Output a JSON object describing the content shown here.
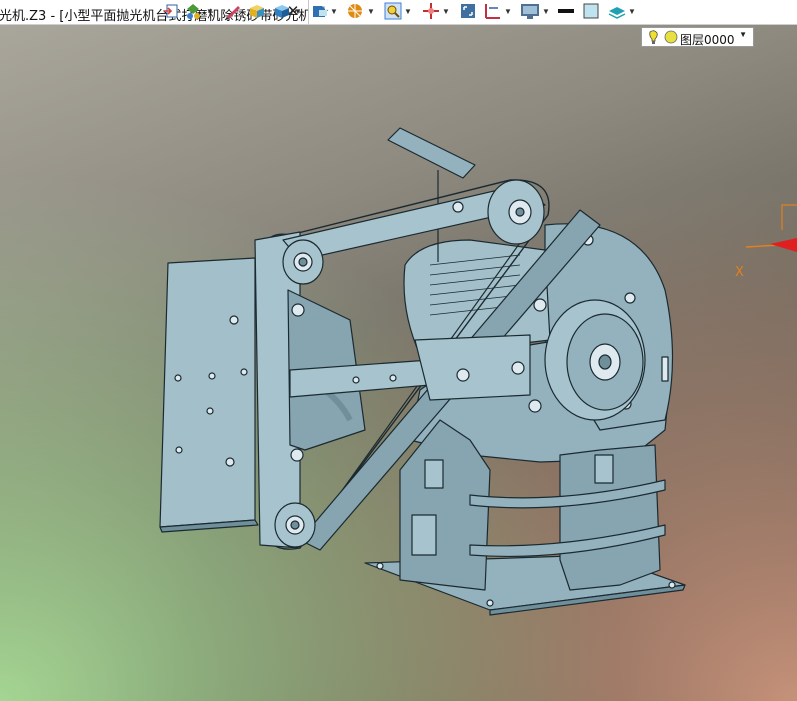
{
  "window": {
    "tab_title": "光机.Z3 - [小型平面抛光机台式打磨机除锈砂带砂光机]",
    "close_glyph": "✕",
    "new_tab_glyph": "+"
  },
  "toolbar": {
    "buttons": [
      {
        "name": "import-icon",
        "color": "#d04040"
      },
      {
        "name": "render-mode-icon",
        "color": "#4a9a3a"
      },
      {
        "name": "pen-icon",
        "color": "#d04060"
      },
      {
        "name": "shaded-box-icon",
        "color": "#e0b020"
      },
      {
        "name": "view-cube-icon",
        "color": "#3080c0"
      },
      {
        "name": "section-view-icon",
        "color": "#3070b0"
      },
      {
        "name": "display-style-icon",
        "color": "#e08a10"
      },
      {
        "name": "zoom-icon",
        "color": "#3d7fd0"
      },
      {
        "name": "pan-icon",
        "color": "#c03030"
      },
      {
        "name": "fit-view-icon",
        "color": "#4070a0"
      },
      {
        "name": "measure-icon",
        "color": "#c03040"
      },
      {
        "name": "monitor-icon",
        "color": "#507090"
      },
      {
        "name": "line-color-icon",
        "color": "#111111"
      },
      {
        "name": "fill-color-icon",
        "color": "#bfe4f0"
      },
      {
        "name": "layer-manager-icon",
        "color": "#20a0b0"
      }
    ]
  },
  "layer_selector": {
    "value": "图层0000",
    "bulb_color": "#f0e030"
  },
  "viewport": {
    "axis_label": "X",
    "model_color": "#93b2be",
    "edge_color": "#1b2a30"
  }
}
